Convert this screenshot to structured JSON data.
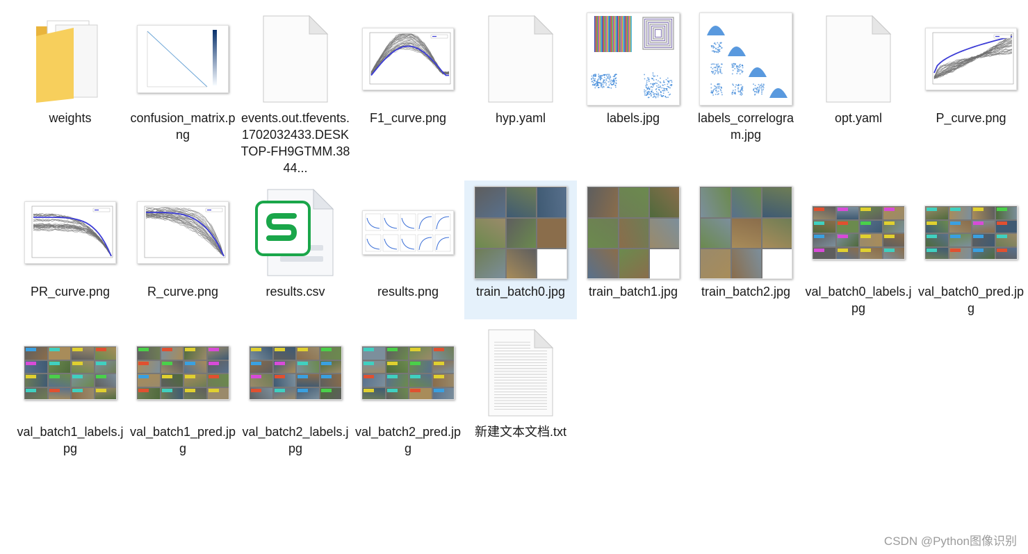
{
  "files": [
    {
      "name": "weights",
      "kind": "folder"
    },
    {
      "name": "confusion_matrix.png",
      "kind": "confusion"
    },
    {
      "name": "events.out.tfevents.1702032433.DESKTOP-FH9GTMM.3844...",
      "kind": "blank"
    },
    {
      "name": "F1_curve.png",
      "kind": "f1curve"
    },
    {
      "name": "hyp.yaml",
      "kind": "blank"
    },
    {
      "name": "labels.jpg",
      "kind": "labels"
    },
    {
      "name": "labels_correlogram.jpg",
      "kind": "correlogram"
    },
    {
      "name": "opt.yaml",
      "kind": "blank"
    },
    {
      "name": "P_curve.png",
      "kind": "pcurve"
    },
    {
      "name": "PR_curve.png",
      "kind": "prcurve"
    },
    {
      "name": "R_curve.png",
      "kind": "rcurve"
    },
    {
      "name": "results.csv",
      "kind": "csv"
    },
    {
      "name": "results.png",
      "kind": "results"
    },
    {
      "name": "train_batch0.jpg",
      "kind": "train",
      "selected": true
    },
    {
      "name": "train_batch1.jpg",
      "kind": "train"
    },
    {
      "name": "train_batch2.jpg",
      "kind": "train"
    },
    {
      "name": "val_batch0_labels.jpg",
      "kind": "val"
    },
    {
      "name": "val_batch0_pred.jpg",
      "kind": "val"
    },
    {
      "name": "val_batch1_labels.jpg",
      "kind": "val"
    },
    {
      "name": "val_batch1_pred.jpg",
      "kind": "val"
    },
    {
      "name": "val_batch2_labels.jpg",
      "kind": "val"
    },
    {
      "name": "val_batch2_pred.jpg",
      "kind": "val"
    },
    {
      "name": "新建文本文档.txt",
      "kind": "txt"
    }
  ],
  "watermark": "CSDN @Python图像识别",
  "colors": {
    "selection": "#e5f1fb",
    "folder": "#f5c84c",
    "csv_green": "#1aa64a",
    "curve_blue": "#3b3bd6"
  }
}
